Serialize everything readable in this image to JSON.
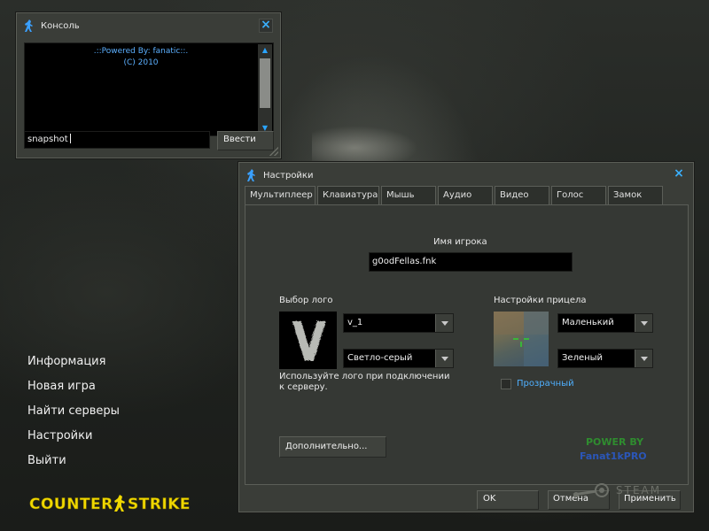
{
  "console": {
    "title": "Консоль",
    "output_lines": [
      ".::Powered By: fanatic::.",
      "(C) 2010"
    ],
    "input_value": "snapshot",
    "submit_label": "Ввести",
    "icon": "counter-terrorist-icon",
    "close_icon": "close-icon"
  },
  "settings": {
    "title": "Настройки",
    "icon": "counter-terrorist-icon",
    "tabs": [
      {
        "label": "Мультиплеер",
        "active": true
      },
      {
        "label": "Клавиатура",
        "active": false
      },
      {
        "label": "Мышь",
        "active": false
      },
      {
        "label": "Аудио",
        "active": false
      },
      {
        "label": "Видео",
        "active": false
      },
      {
        "label": "Голос",
        "active": false
      },
      {
        "label": "Замок",
        "active": false
      }
    ],
    "player_name_label": "Имя игрока",
    "player_name_value": "g0odFellas.fnk",
    "logo": {
      "label": "Выбор лого",
      "logo_value": "v_1",
      "color_value": "Светло-серый",
      "hint": "Используйте лого при подключении к серверу."
    },
    "crosshair": {
      "label": "Настройки прицела",
      "size_value": "Маленький",
      "color_value": "Зеленый",
      "transparent_label": "Прозрачный",
      "transparent_checked": false
    },
    "advanced_label": "Дополнительно...",
    "power_by": [
      "POWER BY",
      "Fanat1kPRO"
    ],
    "ok_label": "OK",
    "cancel_label": "Отмена",
    "apply_label": "Применить"
  },
  "main_menu": {
    "items": [
      "Информация",
      "Новая игра",
      "Найти серверы",
      "Настройки",
      "Выйти"
    ]
  },
  "logo_text": "COUNTER-STRIKE",
  "steam_text": "STEAM",
  "colors": {
    "accent_blue": "#3ab0ff",
    "crosshair_green": "#2f8c2f",
    "power_blue": "#2b56b8",
    "logo_yellow": "#f0d800"
  }
}
